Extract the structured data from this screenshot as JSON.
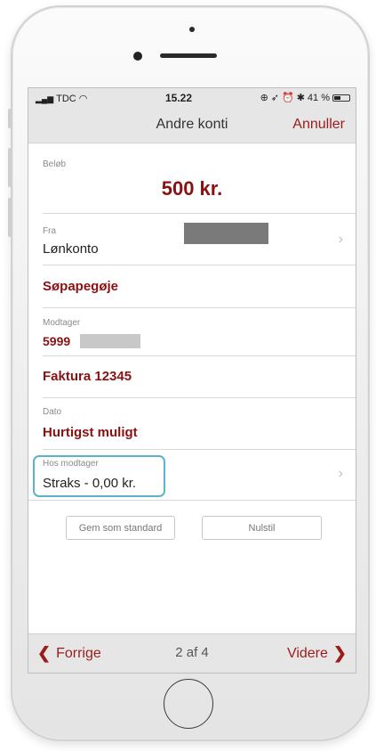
{
  "status": {
    "carrier": "TDC",
    "time": "15.22",
    "battery_text": "41 %",
    "battery_level": 0.41
  },
  "header": {
    "title": "Andre konti",
    "cancel_label": "Annuller"
  },
  "form": {
    "amount": {
      "label": "Beløb",
      "value": "500 kr."
    },
    "from": {
      "label": "Fra",
      "value": "Lønkonto"
    },
    "recipient_name": {
      "value": "Søpapegøje"
    },
    "recipient": {
      "label": "Modtager",
      "value": "5999"
    },
    "reference": {
      "value": "Faktura 12345"
    },
    "date": {
      "label": "Dato",
      "value": "Hurtigst muligt"
    },
    "delivery": {
      "label": "Hos modtager",
      "value": "Straks - 0,00 kr."
    }
  },
  "actions": {
    "save_default_label": "Gem som standard",
    "reset_label": "Nulstil"
  },
  "footer": {
    "prev_label": "Forrige",
    "page_indicator": "2 af 4",
    "next_label": "Videre"
  },
  "colors": {
    "accent": "#9c1c1c",
    "highlight": "#5ab3c9",
    "bar": "#e6e6e6"
  }
}
